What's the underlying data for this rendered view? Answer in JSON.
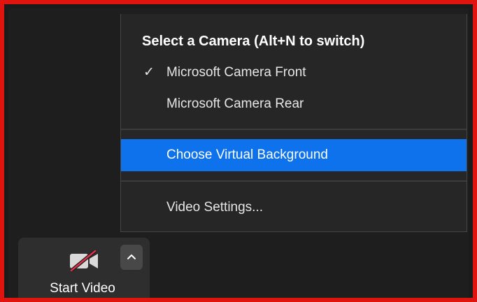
{
  "menu": {
    "header": "Select a Camera (Alt+N to switch)",
    "items": [
      {
        "label": "Microsoft Camera Front",
        "checked": true
      },
      {
        "label": "Microsoft Camera Rear",
        "checked": false
      },
      {
        "label": "Choose Virtual Background",
        "highlighted": true
      },
      {
        "label": "Video Settings..."
      }
    ],
    "check_glyph": "✓"
  },
  "video_button": {
    "label": "Start Video",
    "icon": "video-off-icon",
    "arrow_icon": "chevron-up-icon"
  },
  "colors": {
    "highlight": "#0e72ed",
    "frame_border": "#e0140f",
    "muted_slash": "#e0324b"
  }
}
